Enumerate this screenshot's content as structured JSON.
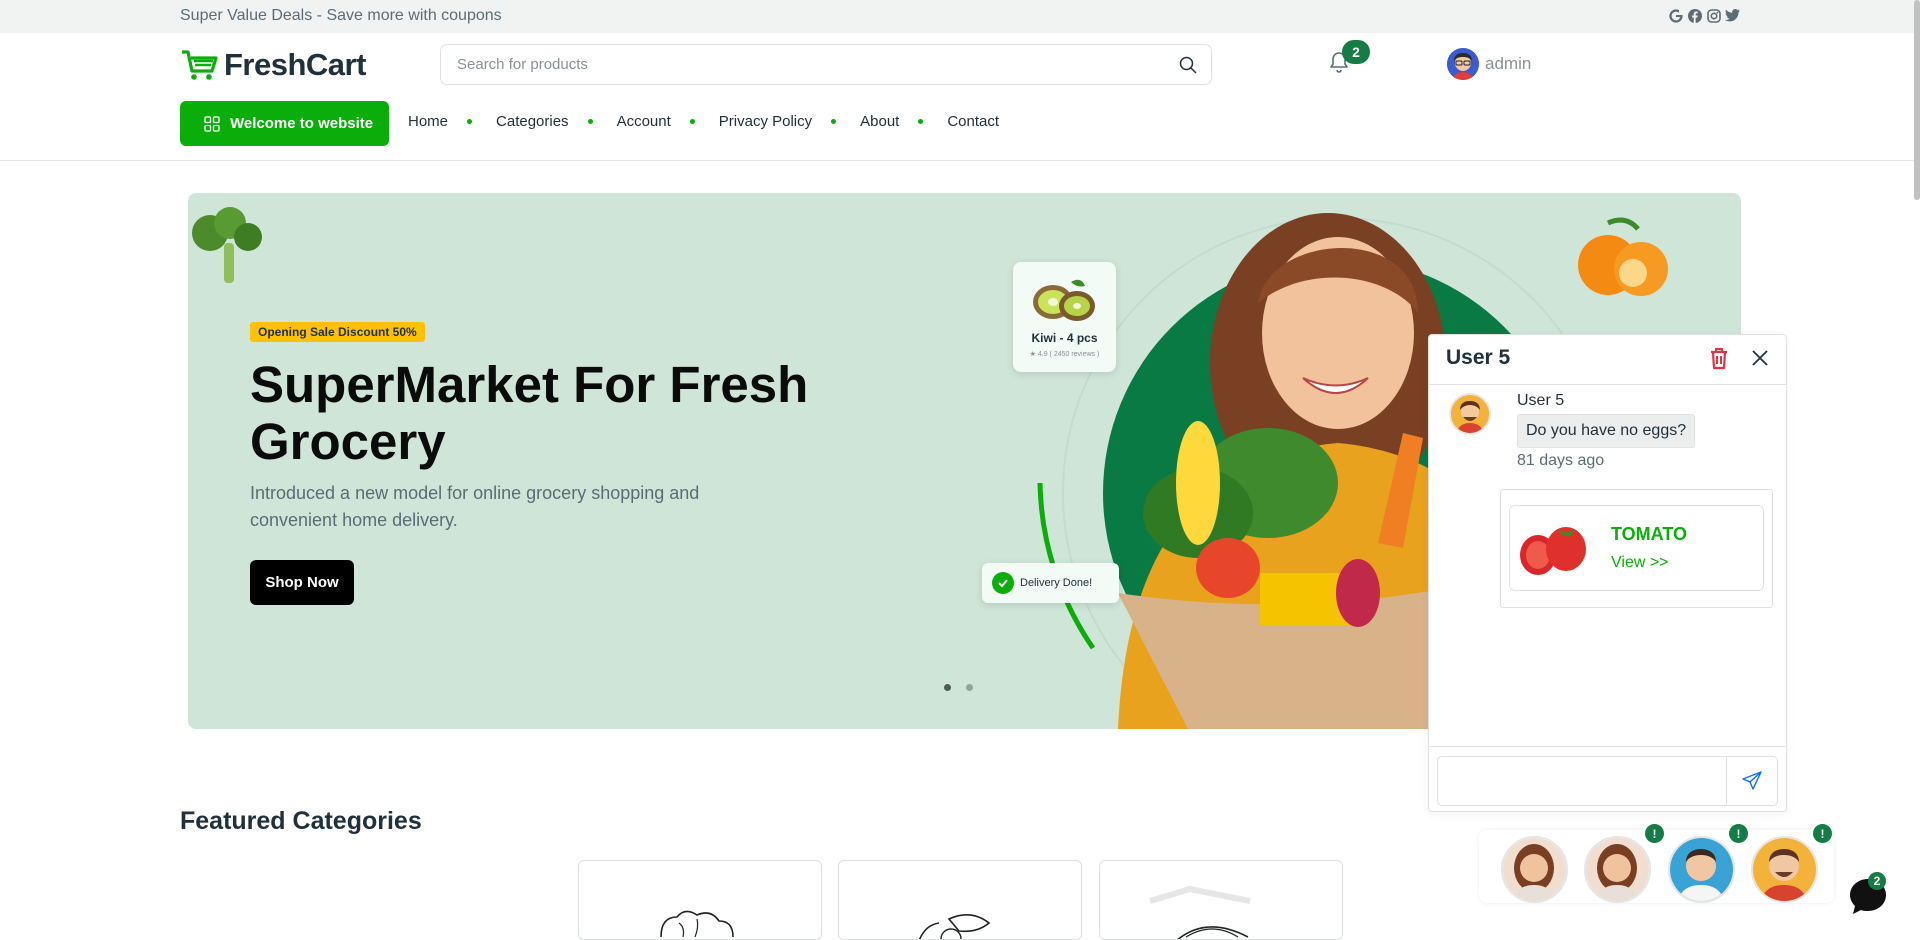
{
  "topbar": {
    "promo": "Super Value Deals - Save more with coupons",
    "social": [
      "G",
      "f",
      "ig",
      "tw"
    ]
  },
  "header": {
    "logo_text": "FreshCart",
    "search_placeholder": "Search for products",
    "notifications_count": "2",
    "username": "admin",
    "welcome_button": "Welcome to website",
    "nav": [
      "Home",
      "Categories",
      "Account",
      "Privacy Policy",
      "About",
      "Contact"
    ]
  },
  "hero": {
    "badge": "Opening Sale Discount 50%",
    "title": "SuperMarket For Fresh Grocery",
    "description": "Introduced a new model for online grocery shopping and convenient home delivery.",
    "button": "Shop Now",
    "kiwi_card": {
      "title": "Kiwi - 4 pcs",
      "rating": "★ 4.9  ( 2450 reviews )"
    },
    "delivery_badge": "Delivery Done!",
    "slides": 2,
    "active_slide": 1
  },
  "featured": {
    "title": "Featured Categories"
  },
  "chat": {
    "title": "User 5",
    "sender": "User 5",
    "message": "Do you have no eggs?",
    "time_ago": "81 days ago",
    "product_name": "TOMATO",
    "product_link": "View >>",
    "input_value": ""
  },
  "chat_heads": {
    "alerts": [
      "!",
      "!",
      "!"
    ],
    "messenger_count": "2"
  },
  "colors": {
    "brand": "#0aad0a",
    "badge": "#147c45",
    "hero_bg": "#cfe5d8",
    "accent_yellow": "#ffc107"
  }
}
